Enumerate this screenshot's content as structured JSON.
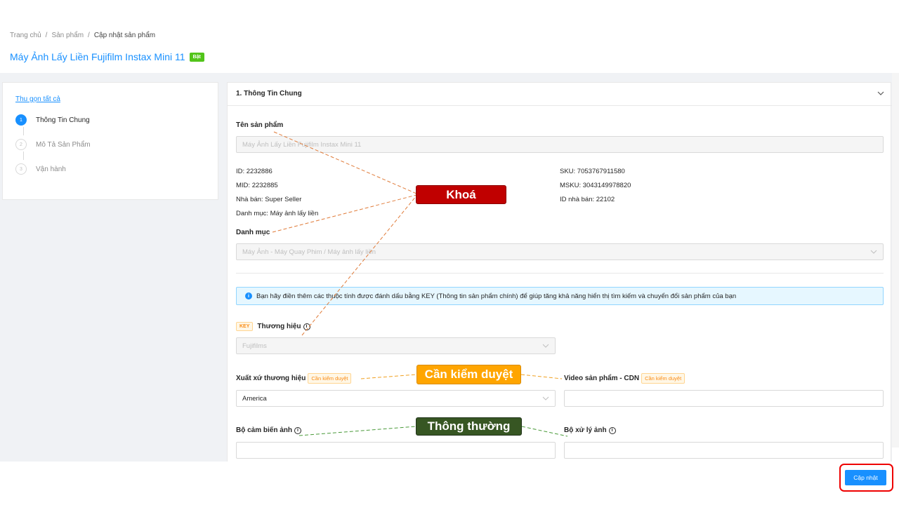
{
  "breadcrumb": [
    "Trang chủ",
    "Sản phẩm",
    "Cập nhật sản phẩm"
  ],
  "breadcrumb_sep": "/",
  "page_title": "Máy Ảnh Lấy Liền Fujifilm Instax Mini 11",
  "status_badge": "Bật",
  "sidebar": {
    "collapse_all": "Thu gọn tất cả",
    "steps": [
      {
        "num": "1",
        "label": "Thông Tin Chung",
        "active": true
      },
      {
        "num": "2",
        "label": "Mô Tả Sản Phẩm",
        "active": false
      },
      {
        "num": "3",
        "label": "Vận hành",
        "active": false
      }
    ]
  },
  "section": {
    "title": "1. Thông Tin Chung",
    "product_name_label": "Tên sản phẩm",
    "product_name_value": "Máy Ảnh Lấy Liền Fujifilm Instax Mini 11",
    "meta_left": [
      "ID:  2232886",
      "MID:  2232885",
      "Nhà bán:  Super Seller",
      "Danh mục:  Máy ảnh lấy liền"
    ],
    "meta_right": [
      "SKU:  7053767911580",
      "MSKU:  3043149978820",
      "ID nhà bán:  22102"
    ],
    "category_label": "Danh mục",
    "category_value": "Máy Ảnh - Máy Quay Phim / Máy ảnh lấy liền",
    "alert_icon": "i",
    "alert_text": "Bạn hãy điền thêm các thuộc tính được đánh dấu bằng KEY (Thông tin sản phẩm chính) để giúp tăng khả năng hiển thị tìm kiếm và chuyển đổi sản phẩm của bạn",
    "key_tag": "KEY",
    "brand_label": "Thương hiệu",
    "info_icon": "i",
    "brand_value": "Fujifilms",
    "origin_label": "Xuất xứ thương hiệu",
    "review_tag": "Cần kiểm duyệt",
    "origin_value": "America",
    "video_label": "Video sản phẩm - CDN",
    "video_value": "",
    "sensor_label": "Bộ cảm biến ảnh",
    "sensor_value": "",
    "processor_label": "Bộ xử lý ảnh",
    "processor_value": ""
  },
  "annotations": {
    "locked": "Khoá",
    "needs_review": "Cần kiểm duyệt",
    "normal": "Thông thường"
  },
  "footer": {
    "update_button": "Cập nhật"
  },
  "colors": {
    "primary": "#1890ff",
    "badge_on": "#52c41a",
    "ann_locked": "#c00000",
    "ann_review": "#ffa500",
    "ann_normal": "#375623",
    "highlight_box": "#e00000"
  }
}
